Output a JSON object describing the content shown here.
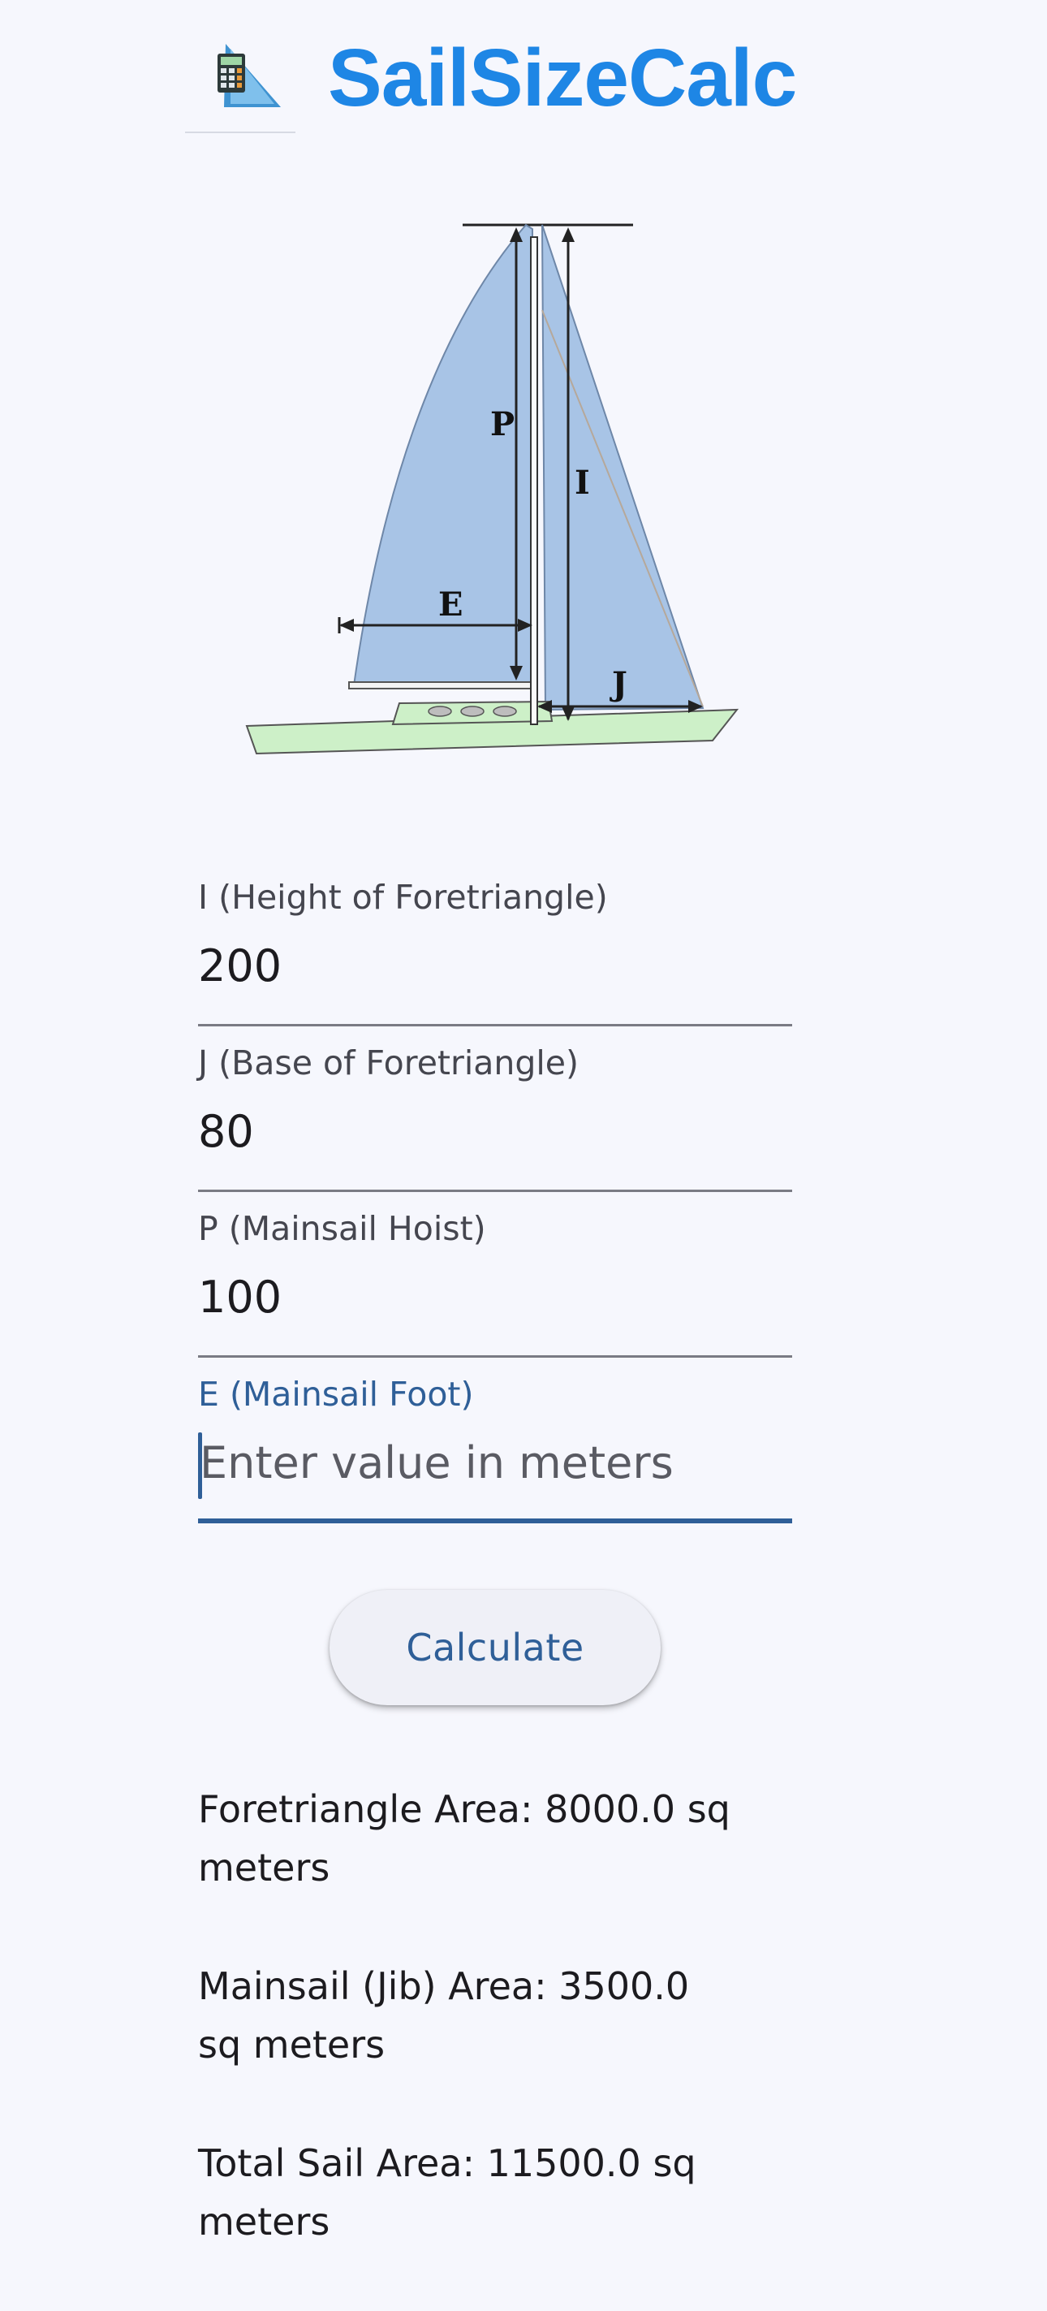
{
  "app": {
    "title": "SailSizeCalc",
    "icon": "calculator-sail-icon"
  },
  "diagram": {
    "labels": {
      "p": "P",
      "i": "I",
      "e": "E",
      "j": "J"
    },
    "colors": {
      "sail": "#a8c4e6",
      "hull": "#cdf0c8"
    }
  },
  "form": {
    "fields": [
      {
        "label": "I (Height of Foretriangle)",
        "value": "200",
        "placeholder": ""
      },
      {
        "label": "J (Base of Foretriangle)",
        "value": "80",
        "placeholder": ""
      },
      {
        "label": "P (Mainsail Hoist)",
        "value": "100",
        "placeholder": ""
      },
      {
        "label": "E (Mainsail Foot)",
        "value": "",
        "placeholder": "Enter value in meters"
      }
    ]
  },
  "calculate_label": "Calculate",
  "results": {
    "foretriangle": "Foretriangle Area: 8000.0 sq\nmeters",
    "mainsail": "Mainsail (Jib) Area: 3500.0\nsq meters",
    "total": "Total Sail Area: 11500.0 sq\nmeters"
  },
  "colors": {
    "brand": "#1e86e5",
    "accent": "#2f5f98",
    "background": "#f6f7fd"
  }
}
